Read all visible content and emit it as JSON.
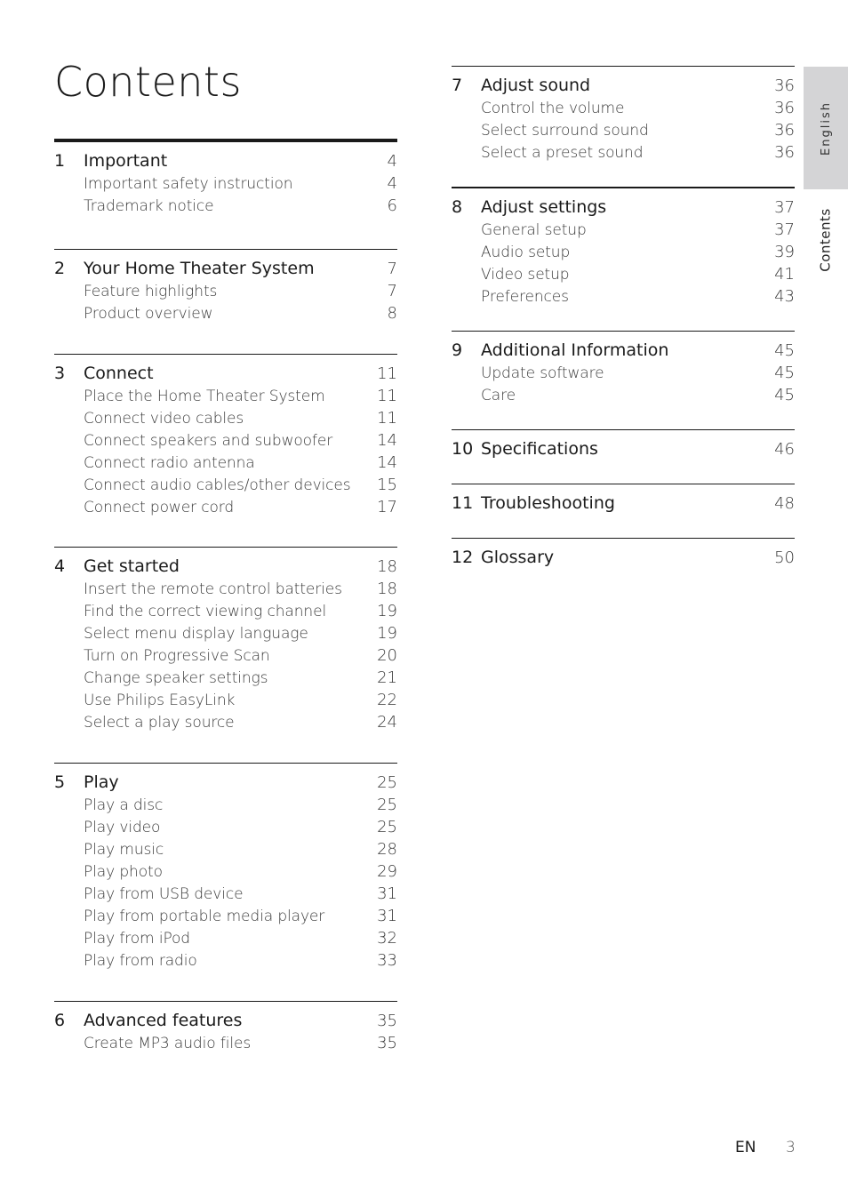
{
  "page_title": "Contents",
  "side_tabs": {
    "language": "English",
    "section": "Contents"
  },
  "footer": {
    "language_code": "EN",
    "page_number": "3"
  },
  "toc": {
    "left": [
      {
        "number": "1",
        "title": "Important",
        "page": "4",
        "items": [
          {
            "label": "Important safety instruction",
            "page": "4"
          },
          {
            "label": "Trademark notice",
            "page": "6"
          }
        ]
      },
      {
        "number": "2",
        "title": "Your Home Theater System",
        "page": "7",
        "items": [
          {
            "label": "Feature highlights",
            "page": "7"
          },
          {
            "label": "Product overview",
            "page": "8"
          }
        ]
      },
      {
        "number": "3",
        "title": "Connect",
        "page": "11",
        "items": [
          {
            "label": "Place the Home Theater System",
            "page": "11"
          },
          {
            "label": "Connect video cables",
            "page": "11"
          },
          {
            "label": "Connect speakers and subwoofer",
            "page": "14"
          },
          {
            "label": "Connect radio antenna",
            "page": "14"
          },
          {
            "label": "Connect audio cables/other devices",
            "page": "15"
          },
          {
            "label": "Connect power cord",
            "page": "17"
          }
        ]
      },
      {
        "number": "4",
        "title": "Get started",
        "page": "18",
        "items": [
          {
            "label": "Insert the remote control batteries",
            "page": "18"
          },
          {
            "label": "Find the correct viewing channel",
            "page": "19"
          },
          {
            "label": "Select menu display language",
            "page": "19"
          },
          {
            "label": "Turn on Progressive Scan",
            "page": "20"
          },
          {
            "label": "Change speaker settings",
            "page": "21"
          },
          {
            "label": "Use Philips EasyLink",
            "page": "22"
          },
          {
            "label": "Select a play source",
            "page": "24"
          }
        ]
      },
      {
        "number": "5",
        "title": "Play",
        "page": "25",
        "items": [
          {
            "label": "Play a disc",
            "page": "25"
          },
          {
            "label": "Play video",
            "page": "25"
          },
          {
            "label": "Play music",
            "page": "28"
          },
          {
            "label": "Play photo",
            "page": "29"
          },
          {
            "label": "Play from USB device",
            "page": "31"
          },
          {
            "label": "Play from portable media player",
            "page": "31"
          },
          {
            "label": "Play from iPod",
            "page": "32"
          },
          {
            "label": "Play from radio",
            "page": "33"
          }
        ]
      },
      {
        "number": "6",
        "title": "Advanced features",
        "page": "35",
        "items": [
          {
            "label": "Create MP3 audio files",
            "page": "35"
          }
        ]
      }
    ],
    "right": [
      {
        "number": "7",
        "title": "Adjust sound",
        "page": "36",
        "items": [
          {
            "label": "Control the volume",
            "page": "36"
          },
          {
            "label": "Select surround sound",
            "page": "36"
          },
          {
            "label": "Select a preset sound",
            "page": "36"
          }
        ]
      },
      {
        "number": "8",
        "title": "Adjust settings",
        "page": "37",
        "items": [
          {
            "label": "General setup",
            "page": "37"
          },
          {
            "label": "Audio setup",
            "page": "39"
          },
          {
            "label": "Video setup",
            "page": "41"
          },
          {
            "label": "Preferences",
            "page": "43"
          }
        ]
      },
      {
        "number": "9",
        "title": "Additional Information",
        "page": "45",
        "items": [
          {
            "label": "Update software",
            "page": "45"
          },
          {
            "label": "Care",
            "page": "45"
          }
        ]
      },
      {
        "number": "10",
        "title": "Specifications",
        "page": "46",
        "items": []
      },
      {
        "number": "11",
        "title": "Troubleshooting",
        "page": "48",
        "items": []
      },
      {
        "number": "12",
        "title": "Glossary",
        "page": "50",
        "items": []
      }
    ]
  }
}
